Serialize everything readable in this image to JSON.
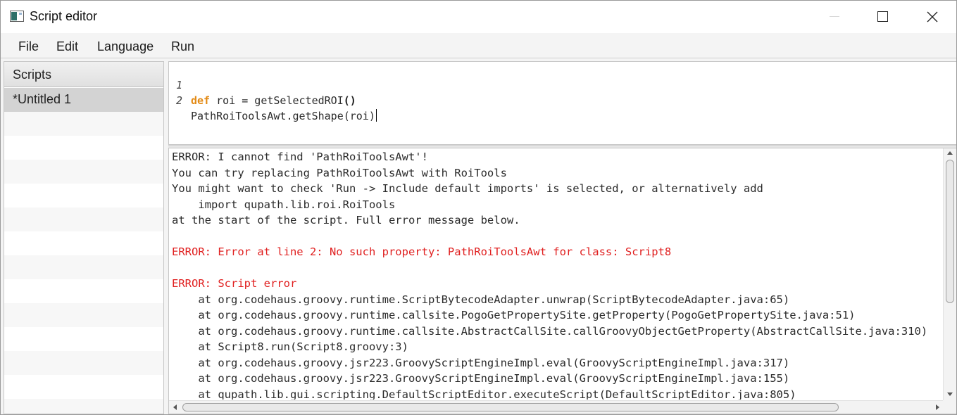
{
  "window": {
    "title": "Script editor",
    "icons": {
      "app": "window-app-icon",
      "minimize": "minimize-icon",
      "maximize": "maximize-icon",
      "close": "close-icon"
    }
  },
  "menu": {
    "file": "File",
    "edit": "Edit",
    "language": "Language",
    "run": "Run"
  },
  "sidebar": {
    "header": "Scripts",
    "items": [
      {
        "label": "*Untitled 1",
        "selected": true
      }
    ]
  },
  "editor": {
    "lines": [
      {
        "number": "1",
        "keyword": "def",
        "text": " roi = getSelectedROI",
        "parens": "()"
      },
      {
        "number": "2",
        "text": "PathRoiToolsAwt.getShape(roi)"
      }
    ]
  },
  "console": {
    "lines": [
      {
        "text": "ERROR: I cannot find 'PathRoiToolsAwt'!",
        "error": false
      },
      {
        "text": "You can try replacing PathRoiToolsAwt with RoiTools",
        "error": false
      },
      {
        "text": "You might want to check 'Run -> Include default imports' is selected, or alternatively add",
        "error": false
      },
      {
        "text": "    import qupath.lib.roi.RoiTools",
        "error": false
      },
      {
        "text": "at the start of the script. Full error message below.",
        "error": false
      },
      {
        "text": "",
        "error": false
      },
      {
        "text": "ERROR: Error at line 2: No such property: PathRoiToolsAwt for class: Script8",
        "error": true
      },
      {
        "text": "",
        "error": false
      },
      {
        "text": "ERROR: Script error",
        "error": true
      },
      {
        "text": "    at org.codehaus.groovy.runtime.ScriptBytecodeAdapter.unwrap(ScriptBytecodeAdapter.java:65)",
        "error": false
      },
      {
        "text": "    at org.codehaus.groovy.runtime.callsite.PogoGetPropertySite.getProperty(PogoGetPropertySite.java:51)",
        "error": false
      },
      {
        "text": "    at org.codehaus.groovy.runtime.callsite.AbstractCallSite.callGroovyObjectGetProperty(AbstractCallSite.java:310)",
        "error": false
      },
      {
        "text": "    at Script8.run(Script8.groovy:3)",
        "error": false
      },
      {
        "text": "    at org.codehaus.groovy.jsr223.GroovyScriptEngineImpl.eval(GroovyScriptEngineImpl.java:317)",
        "error": false
      },
      {
        "text": "    at org.codehaus.groovy.jsr223.GroovyScriptEngineImpl.eval(GroovyScriptEngineImpl.java:155)",
        "error": false
      },
      {
        "text": "    at qupath.lib.gui.scripting.DefaultScriptEditor.executeScript(DefaultScriptEditor.java:805)",
        "error": false
      }
    ]
  },
  "colors": {
    "keyword": "#e38a15",
    "error": "#e02020",
    "selection": "#d3d3d3"
  }
}
